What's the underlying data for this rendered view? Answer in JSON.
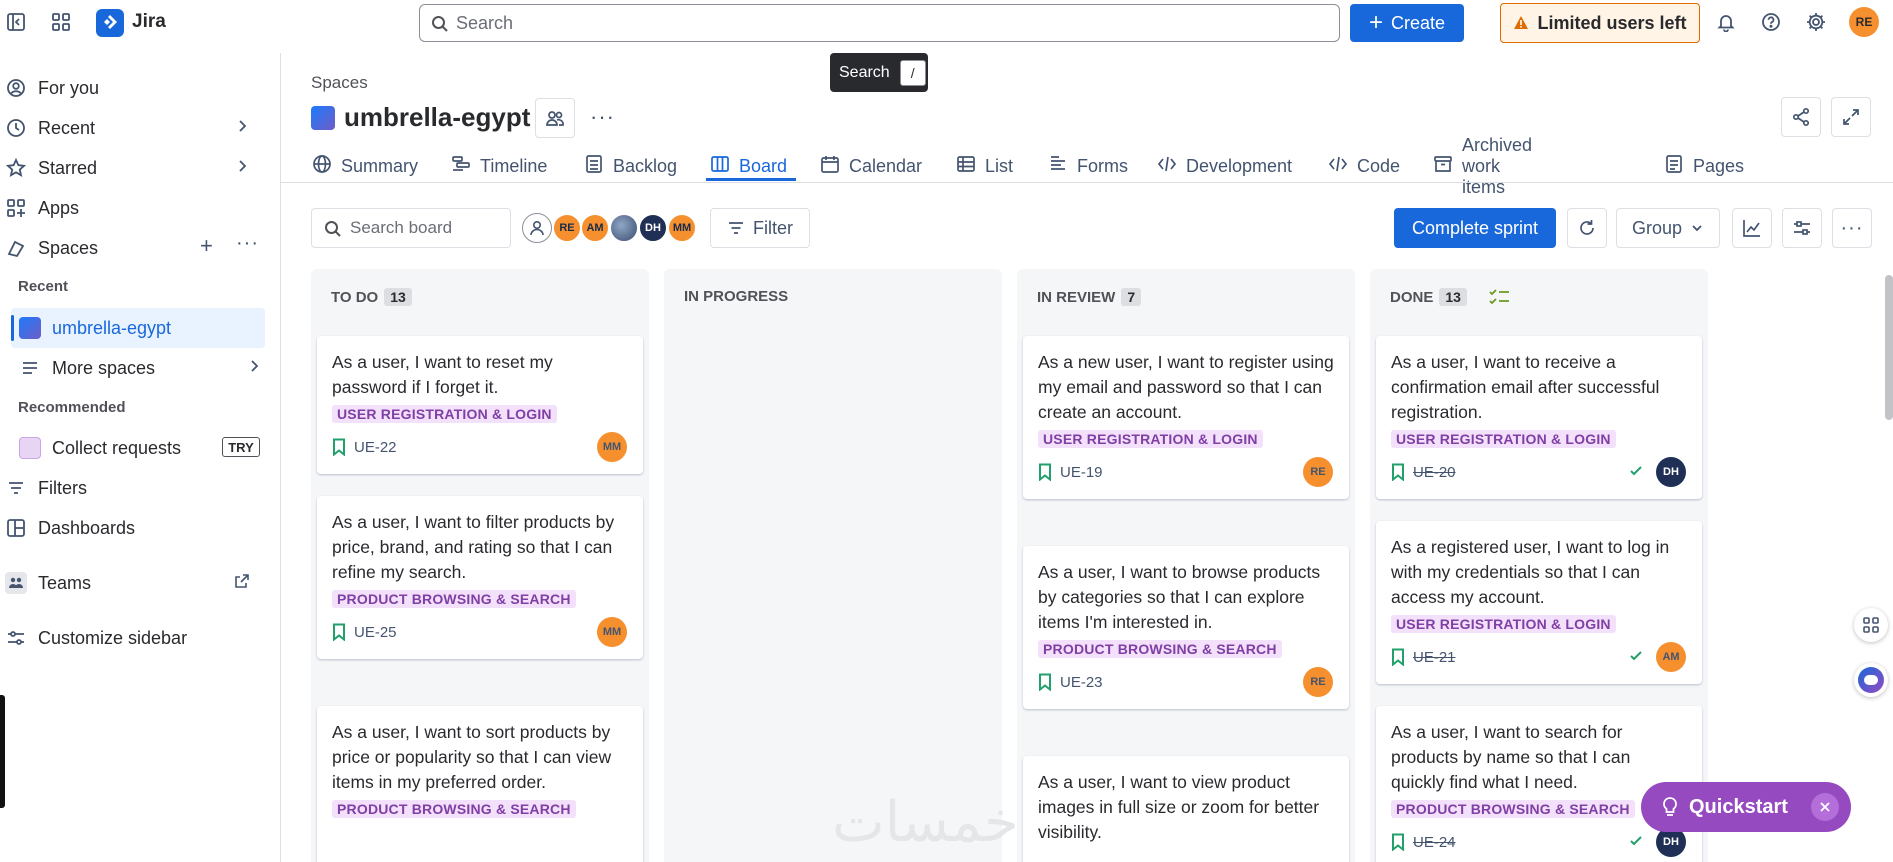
{
  "topbar": {
    "app_name": "Jira",
    "search_placeholder": "Search",
    "create_label": "Create",
    "limited_label": "Limited users left",
    "user_initials": "RE",
    "tooltip_label": "Search",
    "tooltip_key": "/"
  },
  "sidebar": {
    "for_you": "For you",
    "recent": "Recent",
    "starred": "Starred",
    "apps": "Apps",
    "spaces": "Spaces",
    "recent_header": "Recent",
    "active_space": "umbrella-egypt",
    "more_spaces": "More spaces",
    "recommended_header": "Recommended",
    "collect_requests": "Collect requests",
    "try_badge": "TRY",
    "filters": "Filters",
    "dashboards": "Dashboards",
    "teams": "Teams",
    "customize": "Customize sidebar"
  },
  "header": {
    "breadcrumb": "Spaces",
    "title": "umbrella-egypt"
  },
  "tabs": [
    "Summary",
    "Timeline",
    "Backlog",
    "Board",
    "Calendar",
    "List",
    "Forms",
    "Development",
    "Code",
    "Archived work items",
    "Pages"
  ],
  "toolbar": {
    "search_placeholder": "Search board",
    "avatars": [
      "RE",
      "AM",
      "",
      "DH",
      "MM"
    ],
    "filter_label": "Filter",
    "complete_sprint": "Complete sprint",
    "group_label": "Group"
  },
  "colors": {
    "accent": "#1868db",
    "label_bg": "#f3e0fb",
    "label_fg": "#803fa5",
    "avatar_orange": "#f6902f",
    "avatar_navy": "#1f2f55"
  },
  "columns": [
    {
      "name": "TO DO",
      "count": "13",
      "cards": [
        {
          "title": "As a user, I want to reset my password if I forget it.",
          "label": "USER REGISTRATION & LOGIN",
          "key": "UE-22",
          "assignee": "MM"
        },
        {
          "title": "As a user, I want to filter products by price, brand, and rating so that I can refine my search.",
          "label": "PRODUCT BROWSING & SEARCH",
          "key": "UE-25",
          "assignee": "MM"
        },
        {
          "title": "As a user, I want to sort products by price or popularity so that I can view items in my preferred order.",
          "label": "PRODUCT BROWSING & SEARCH",
          "key": "",
          "assignee": ""
        }
      ]
    },
    {
      "name": "IN PROGRESS",
      "count": "",
      "cards": []
    },
    {
      "name": "IN REVIEW",
      "count": "7",
      "cards": [
        {
          "title": "As a new user, I want to register using my email and password so that I can create an account.",
          "label": "USER REGISTRATION & LOGIN",
          "key": "UE-19",
          "assignee": "RE"
        },
        {
          "title": "As a user, I want to browse products by categories so that I can explore items I'm interested in.",
          "label": "PRODUCT BROWSING & SEARCH",
          "key": "UE-23",
          "assignee": "RE"
        },
        {
          "title": "As a user, I want to view product images in full size or zoom for better visibility.",
          "label": "",
          "key": "",
          "assignee": ""
        }
      ]
    },
    {
      "name": "DONE",
      "count": "13",
      "cards": [
        {
          "title": "As a user, I want to receive a confirmation email after successful registration.",
          "label": "USER REGISTRATION & LOGIN",
          "key": "UE-20",
          "assignee": "DH"
        },
        {
          "title": "As a registered user, I want to log in with my credentials so that I can access my account.",
          "label": "USER REGISTRATION & LOGIN",
          "key": "UE-21",
          "assignee": "AM"
        },
        {
          "title": "As a user, I want to search for products by name so that I can quickly find what I need.",
          "label": "PRODUCT BROWSING & SEARCH",
          "key": "UE-24",
          "assignee": "DH"
        }
      ]
    }
  ],
  "quickstart": "Quickstart",
  "watermark": "خمسات"
}
